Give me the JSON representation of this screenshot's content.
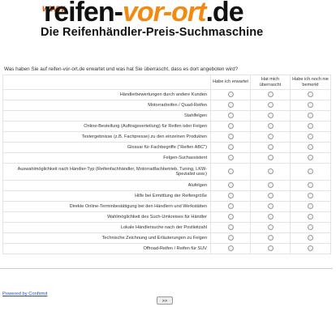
{
  "header": {
    "logo_www": "www",
    "logo_part1": "reifen-",
    "logo_part2": "vor-ort",
    "logo_part3": ".de",
    "tagline": "Die Reifenhändler-Preis-Suchmaschine"
  },
  "survey": {
    "question": "Was haben Sie auf reifen-vor-ort.de erwartet und was hat Sie überrascht, dass es dort angeboten wird?",
    "columns": [
      "Habe ich erwartet",
      "Hat mich überrascht",
      "Habe ich noch nie bemerkt"
    ],
    "rows": [
      "Händlerbewertungen durch andere Kunden",
      "Motorradreifen / Quad-Reifen",
      "Stahlfelgen",
      "Online-Bestellung (Auftragsverteilung) für Reifen oder Felgen",
      "Testergebnisse (z.B. Fachpresse) zu den einzelnen Produkten",
      "Glossar für Fachbegriffe (\"Reifen ABC\")",
      "Felgen-Suchassistent",
      "Auswahlmöglichkeit nach Händler-Typ (Reifenfachhändler, Motorradfachbetrieb, Tuning, LKW-Spezialist usw.)",
      "Alufelgen",
      "Hilfe bei Ermittlung der Reifengröße",
      "Direkte Online-Terminbestätigung bei den Händlern und Werkstätten",
      "Wahlmöglichkeit des Such-Umkreises für Händler",
      "Lokale Händlersuche nach der Postleitzahl",
      "Technische Zeichnung und Erläuterungen zu Felgen",
      "Offroad-Reifen / Reifen für SUV"
    ]
  },
  "footer": {
    "powered_by": "Powered by Confirmit",
    "next_label": ">>"
  }
}
